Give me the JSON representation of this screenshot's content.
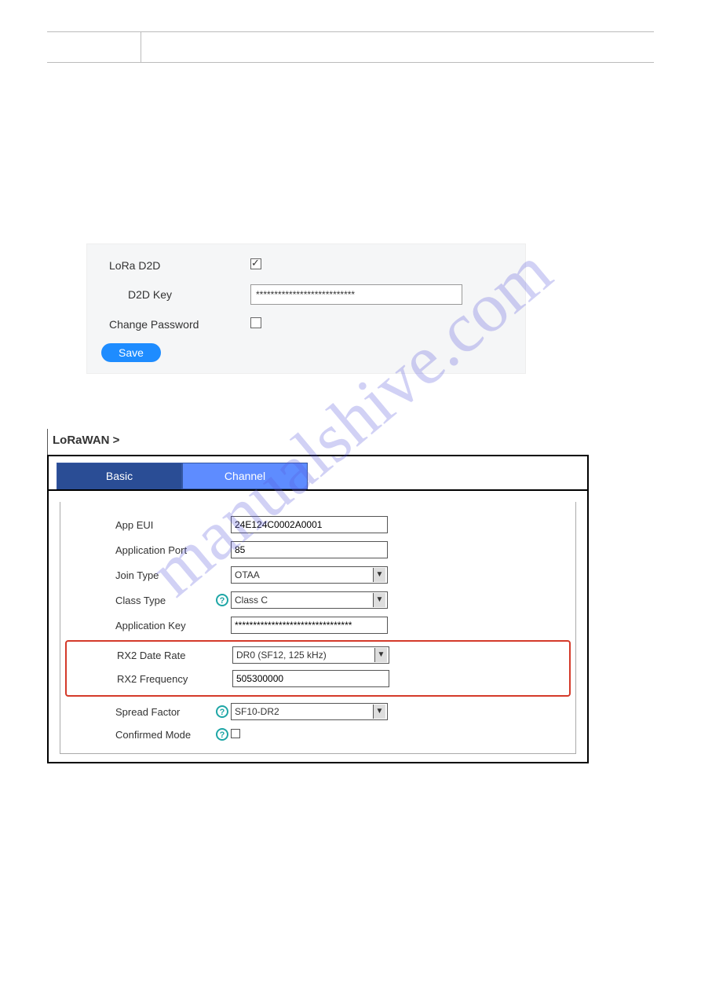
{
  "watermark": "manualshive.com",
  "panel1": {
    "lora_d2d_label": "LoRa D2D",
    "lora_d2d_checked": true,
    "d2d_key_label": "D2D Key",
    "d2d_key_value": "***************************",
    "change_password_label": "Change Password",
    "change_password_checked": false,
    "save_label": "Save"
  },
  "panel2": {
    "breadcrumb": "LoRaWAN >",
    "tab_basic": "Basic",
    "tab_channel": "Channel",
    "fields": {
      "app_eui_label": "App EUI",
      "app_eui_value": "24E124C0002A0001",
      "app_port_label": "Application Port",
      "app_port_value": "85",
      "join_type_label": "Join Type",
      "join_type_value": "OTAA",
      "class_type_label": "Class Type",
      "class_type_value": "Class C",
      "app_key_label": "Application Key",
      "app_key_value": "********************************",
      "rx2_dr_label": "RX2 Date Rate",
      "rx2_dr_value": "DR0 (SF12, 125 kHz)",
      "rx2_freq_label": "RX2 Frequency",
      "rx2_freq_value": "505300000",
      "sf_label": "Spread Factor",
      "sf_value": "SF10-DR2",
      "confirmed_label": "Confirmed Mode",
      "confirmed_checked": false
    }
  }
}
